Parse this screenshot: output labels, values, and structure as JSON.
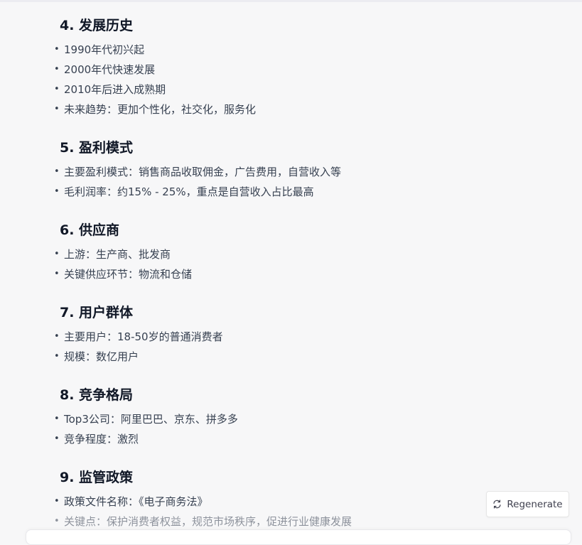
{
  "sections": [
    {
      "heading": "4. 发展历史",
      "items": [
        "1990年代初兴起",
        "2000年代快速发展",
        "2010年后进入成熟期",
        "未来趋势：更加个性化，社交化，服务化"
      ]
    },
    {
      "heading": "5. 盈利模式",
      "items": [
        "主要盈利模式：销售商品收取佣金，广告费用，自营收入等",
        "毛利润率：约15% - 25%，重点是自营收入占比最高"
      ]
    },
    {
      "heading": "6. 供应商",
      "items": [
        "上游：生产商、批发商",
        "关键供应环节：物流和仓储"
      ]
    },
    {
      "heading": "7. 用户群体",
      "items": [
        "主要用户：18-50岁的普通消费者",
        "规模：数亿用户"
      ]
    },
    {
      "heading": "8. 竞争格局",
      "items": [
        "Top3公司：阿里巴巴、京东、拼多多",
        "竞争程度：激烈"
      ]
    },
    {
      "heading": "9. 监管政策",
      "items": [
        "政策文件名称：《电子商务法》",
        "关键点：保护消费者权益，规范市场秩序，促进行业健康发展"
      ]
    }
  ],
  "bullet_glyph": "•",
  "regenerate": {
    "label": "Regenerate",
    "icon": "refresh-icon"
  }
}
